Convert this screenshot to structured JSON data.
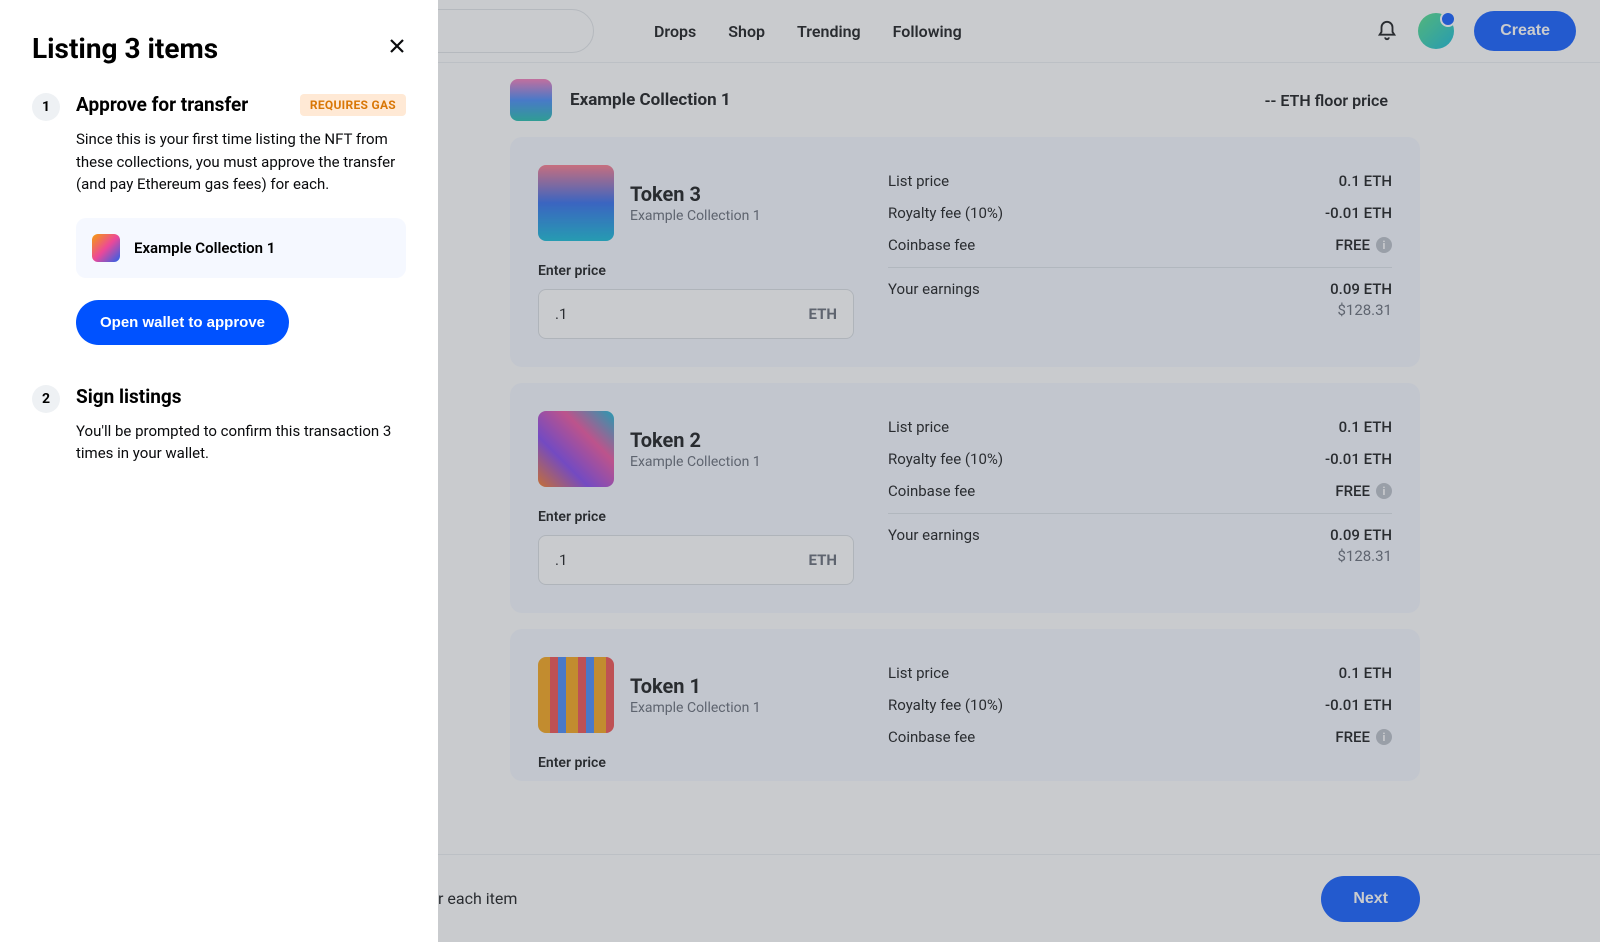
{
  "nav": {
    "drops": "Drops",
    "shop": "Shop",
    "trending": "Trending",
    "following": "Following",
    "create": "Create"
  },
  "collection": {
    "name": "Example Collection 1",
    "floor": "-- ETH floor price"
  },
  "tokens": [
    {
      "name": "Token 3",
      "coll": "Example Collection 1",
      "enter": "Enter price",
      "price": ".1",
      "cur": "ETH",
      "list_lbl": "List price",
      "list_val": "0.1 ETH",
      "roy_lbl": "Royalty fee (10%)",
      "roy_val": "-0.01 ETH",
      "cb_lbl": "Coinbase fee",
      "cb_val": "FREE",
      "earn_lbl": "Your earnings",
      "earn_val": "0.09 ETH",
      "usd": "$128.31"
    },
    {
      "name": "Token 2",
      "coll": "Example Collection 1",
      "enter": "Enter price",
      "price": ".1",
      "cur": "ETH",
      "list_lbl": "List price",
      "list_val": "0.1 ETH",
      "roy_lbl": "Royalty fee (10%)",
      "roy_val": "-0.01 ETH",
      "cb_lbl": "Coinbase fee",
      "cb_val": "FREE",
      "earn_lbl": "Your earnings",
      "earn_val": "0.09 ETH",
      "usd": "$128.31"
    },
    {
      "name": "Token 1",
      "coll": "Example Collection 1",
      "enter": "Enter price",
      "list_lbl": "List price",
      "list_val": "0.1 ETH",
      "roy_lbl": "Royalty fee (10%)",
      "roy_val": "-0.01 ETH",
      "cb_lbl": "Coinbase fee",
      "cb_val": "FREE"
    }
  ],
  "footer": {
    "text": "r each item",
    "next": "Next"
  },
  "panel": {
    "title": "Listing 3 items",
    "step1": {
      "title": "Approve for transfer",
      "badge": "REQUIRES GAS",
      "desc": "Since this is your first time listing the NFT from these collections, you must approve the transfer (and pay Ethereum gas fees) for each.",
      "coll": "Example Collection 1",
      "approve": "Open wallet to approve"
    },
    "step2": {
      "title": "Sign listings",
      "desc": "You'll be prompted to confirm this transaction 3 times in your wallet."
    }
  }
}
